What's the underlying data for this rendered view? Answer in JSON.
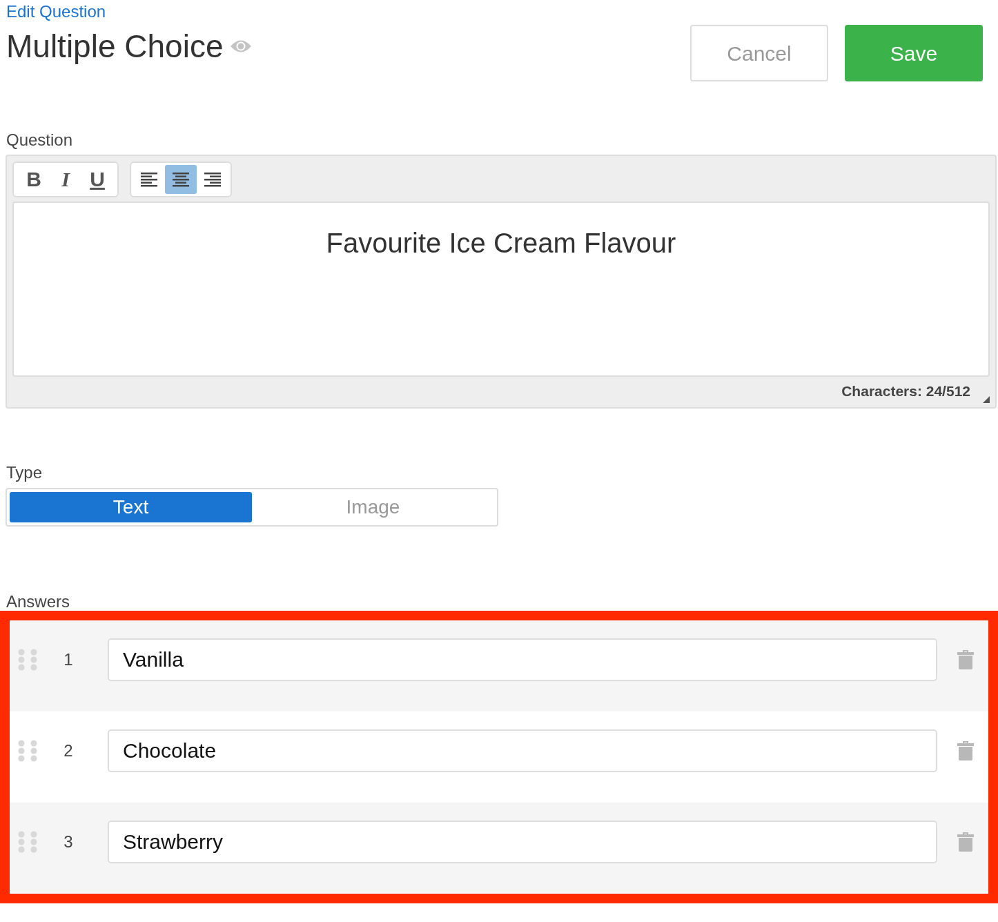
{
  "header": {
    "breadcrumb": "Edit Question",
    "title": "Multiple Choice",
    "buttons": [
      {
        "label": "Cancel",
        "kind": "secondary"
      },
      {
        "label": "Save",
        "kind": "primary"
      }
    ]
  },
  "question": {
    "label": "Question",
    "format_buttons": [
      {
        "label": "B",
        "kind": "bold"
      },
      {
        "label": "I",
        "kind": "italic"
      },
      {
        "label": "U",
        "kind": "underline"
      }
    ],
    "align_buttons": [
      {
        "kind": "left",
        "selected": false
      },
      {
        "kind": "center",
        "selected": true
      },
      {
        "kind": "right",
        "selected": false
      }
    ],
    "text": "Favourite Ice Cream Flavour",
    "counter": "Characters: 24/512"
  },
  "type": {
    "label": "Type",
    "options": [
      {
        "label": "Text",
        "selected": true
      },
      {
        "label": "Image",
        "selected": false
      }
    ]
  },
  "answers": {
    "label": "Answers",
    "highlighted": true,
    "items": [
      {
        "number": "1",
        "value": "Vanilla"
      },
      {
        "number": "2",
        "value": "Chocolate"
      },
      {
        "number": "3",
        "value": "Strawberry"
      }
    ]
  }
}
